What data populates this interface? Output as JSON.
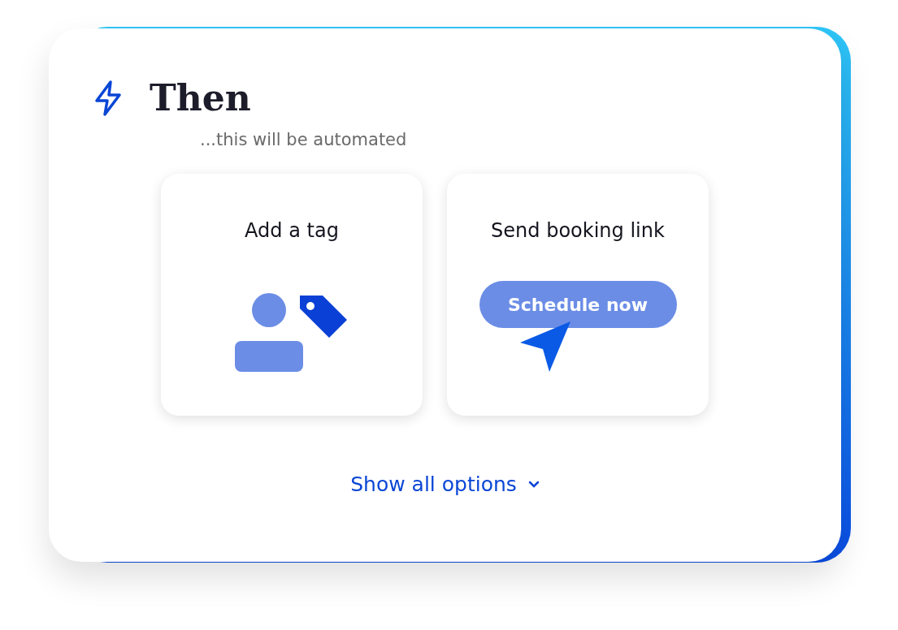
{
  "header": {
    "title": "Then",
    "subtitle": "...this will be automated"
  },
  "actions": [
    {
      "kind": "tag",
      "title": "Add a tag"
    },
    {
      "kind": "booking",
      "title": "Send booking link",
      "button": "Schedule now"
    }
  ],
  "footer": {
    "link": "Show all options"
  }
}
